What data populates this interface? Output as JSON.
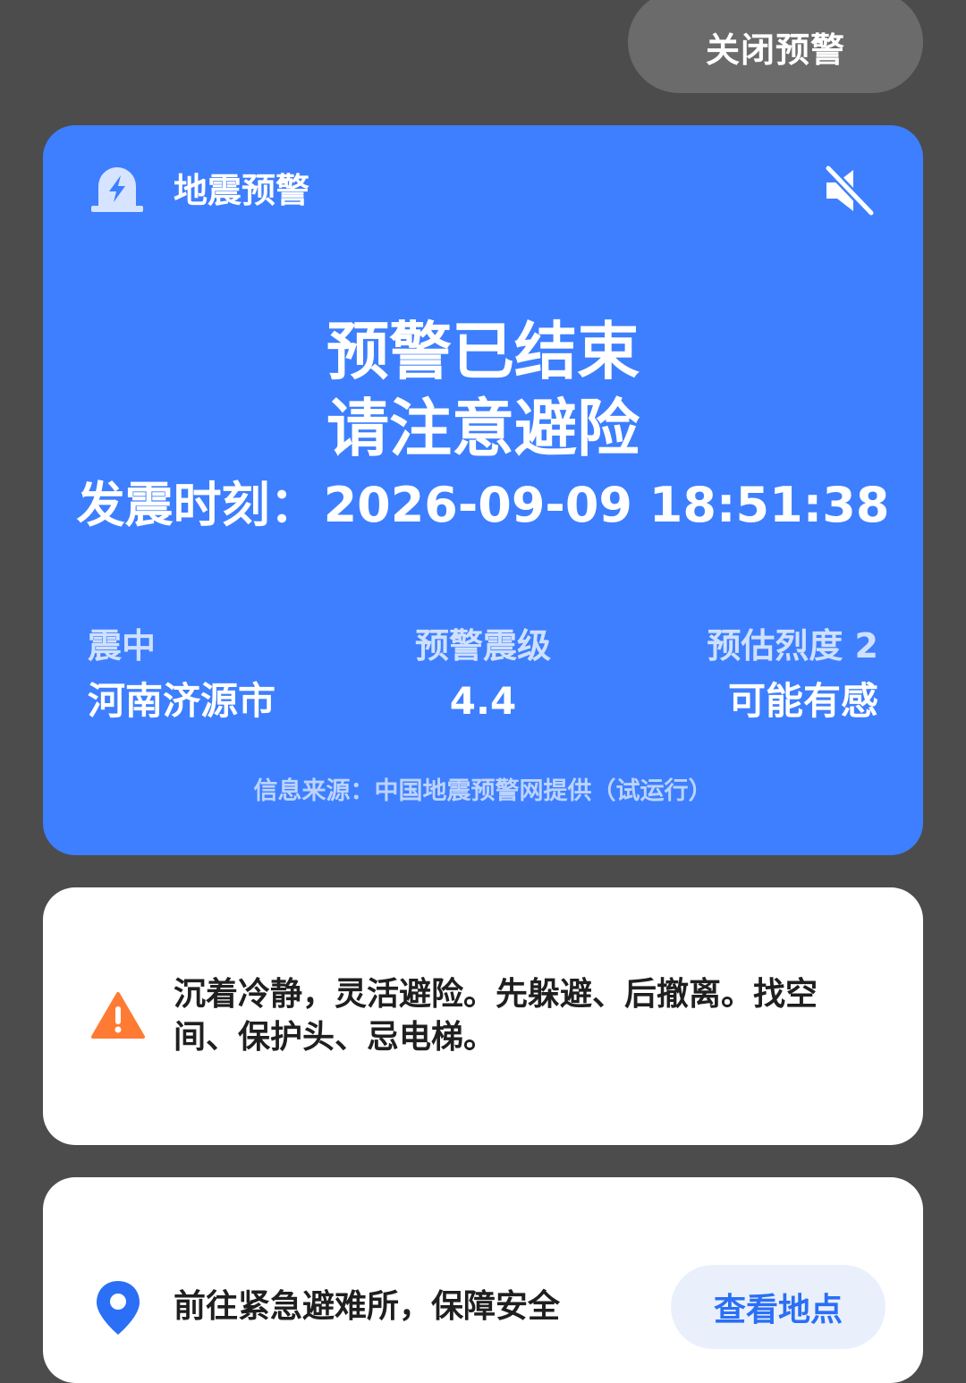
{
  "top": {
    "close_label": "关闭预警"
  },
  "alert": {
    "header_title": "地震预警",
    "status_line1": "预警已结束",
    "status_line2": "请注意避险",
    "time_label": "发震时刻：",
    "time_value": "2026-09-09 18:51:38",
    "epicenter_label": "震中",
    "epicenter_value": "河南济源市",
    "magnitude_label": "预警震级",
    "magnitude_value": "4.4",
    "intensity_label": "预估烈度 2",
    "intensity_value": "可能有感",
    "source": "信息来源：中国地震预警网提供（试运行）",
    "background_color": "#3d7fff"
  },
  "tip": {
    "text": "沉着冷静，灵活避险。先躲避、后撤离。找空间、保护头、忌电梯。",
    "icon": "warning-icon",
    "icon_color": "#ff7a33"
  },
  "shelter": {
    "text": "前往紧急避难所，保障安全",
    "button_label": "查看地点",
    "icon": "location-pin-icon",
    "icon_color": "#2a6ff5"
  }
}
